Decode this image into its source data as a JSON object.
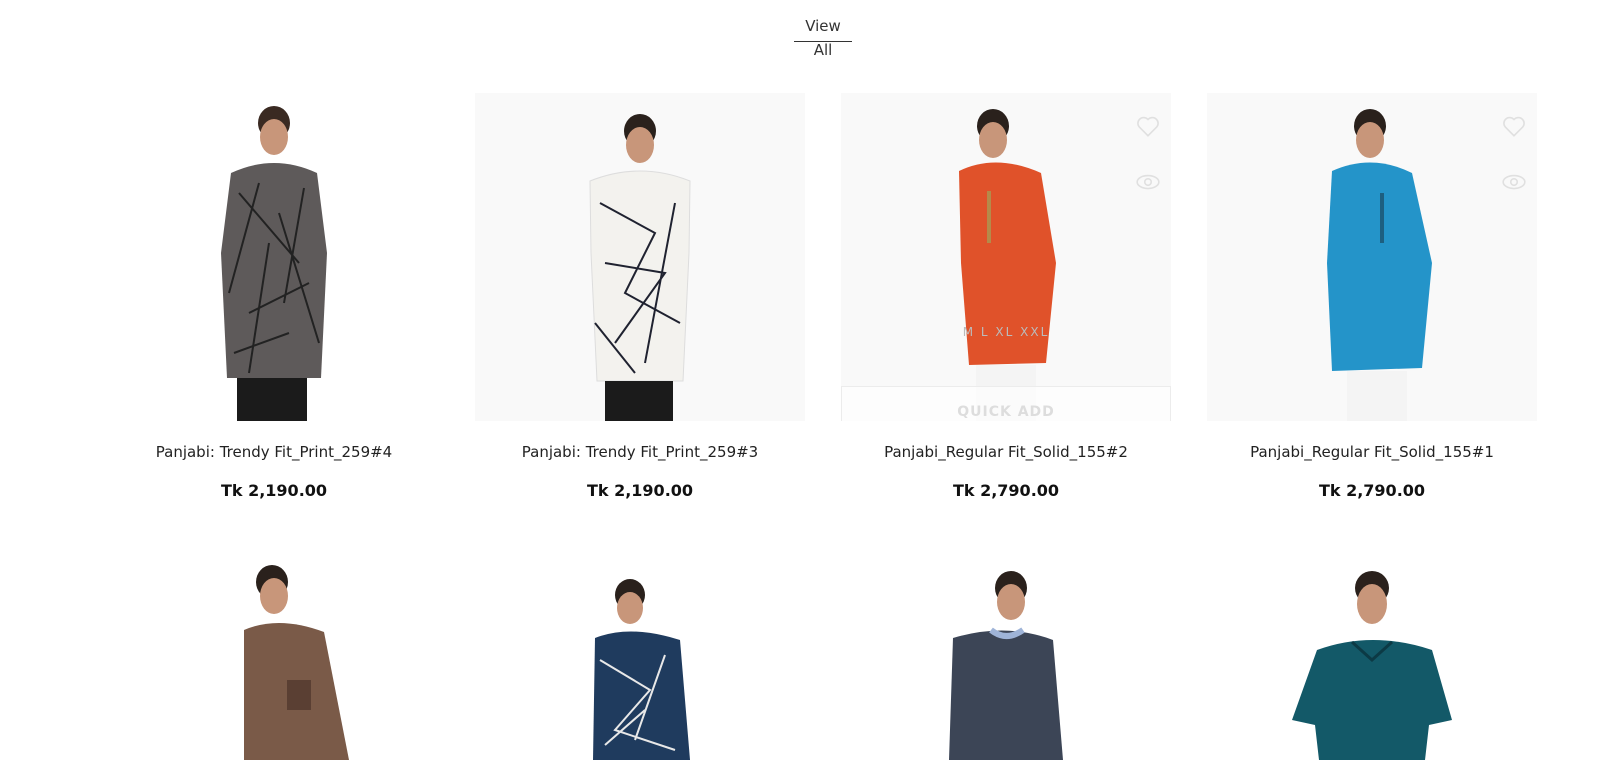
{
  "header": {
    "view_all_label": "View All"
  },
  "products": [
    {
      "title": "Panjabi: Trendy Fit_Print_259#4",
      "price": "Tk 2,190.00",
      "color": "#5e5a5a",
      "pattern": "print-dark"
    },
    {
      "title": "Panjabi: Trendy Fit_Print_259#3",
      "price": "Tk 2,190.00",
      "color": "#f3f2ee",
      "pattern": "print-light"
    },
    {
      "title": "Panjabi_Regular Fit_Solid_155#2",
      "price": "Tk 2,790.00",
      "color": "#e0522a",
      "pattern": "solid",
      "sizes": "M   L   XL   XXL",
      "quick_add_label": "QUICK ADD"
    },
    {
      "title": "Panjabi_Regular Fit_Solid_155#1",
      "price": "Tk 2,790.00",
      "color": "#2494c9",
      "pattern": "solid"
    }
  ],
  "products_row2": [
    {
      "color": "#7a5a48"
    },
    {
      "color": "#1f3b5e"
    },
    {
      "color": "#3c4556"
    },
    {
      "color": "#135968"
    }
  ],
  "icons": {
    "wishlist": "heart-icon",
    "quick_view": "eye-icon"
  }
}
